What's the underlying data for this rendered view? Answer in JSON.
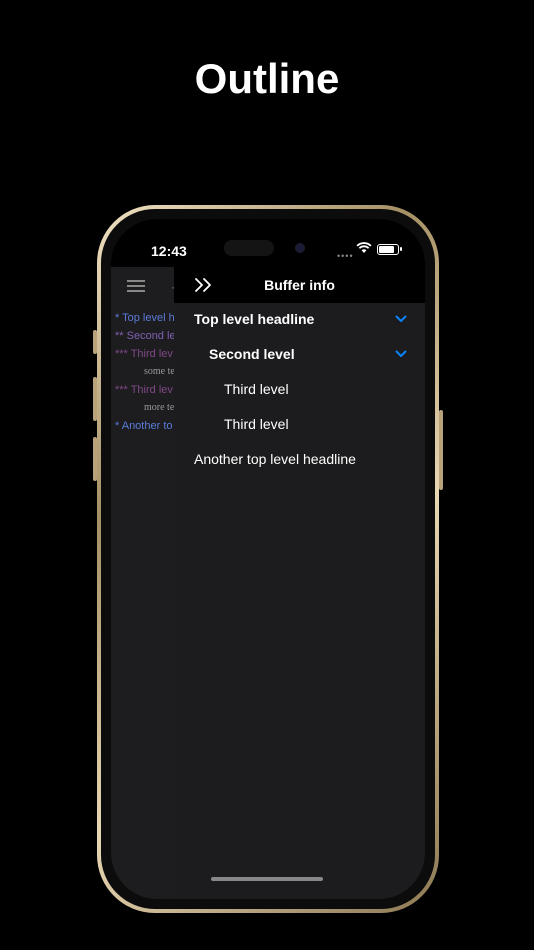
{
  "headline": "Outline",
  "status": {
    "time": "12:43"
  },
  "editor": {
    "lines": [
      {
        "text": "* Top level h",
        "level": 1
      },
      {
        "text": "** Second le",
        "level": 2
      },
      {
        "text": "*** Third lev",
        "level": 3
      },
      {
        "text": "some te",
        "level": 0
      },
      {
        "text": "*** Third lev",
        "level": 3
      },
      {
        "text": "more te",
        "level": 0
      },
      {
        "text": "* Another to",
        "level": 1
      }
    ]
  },
  "panel": {
    "title": "Buffer info",
    "items": [
      {
        "label": "Top level headline",
        "level": 1,
        "expanded": true
      },
      {
        "label": "Second level",
        "level": 2,
        "expanded": true
      },
      {
        "label": "Third level",
        "level": 3
      },
      {
        "label": "Third level",
        "level": 3
      },
      {
        "label": "Another top level headline",
        "level": 1
      }
    ]
  },
  "colors": {
    "accent": "#0a84ff",
    "headline_level1": "#5b7bd8",
    "headline_level2": "#8060b0",
    "headline_level3": "#804888",
    "panel_bg": "#1c1c1e"
  },
  "icons": [
    "menu-icon",
    "collapse-sidebar-icon",
    "chevron-down-icon",
    "wifi-icon",
    "battery-icon"
  ]
}
